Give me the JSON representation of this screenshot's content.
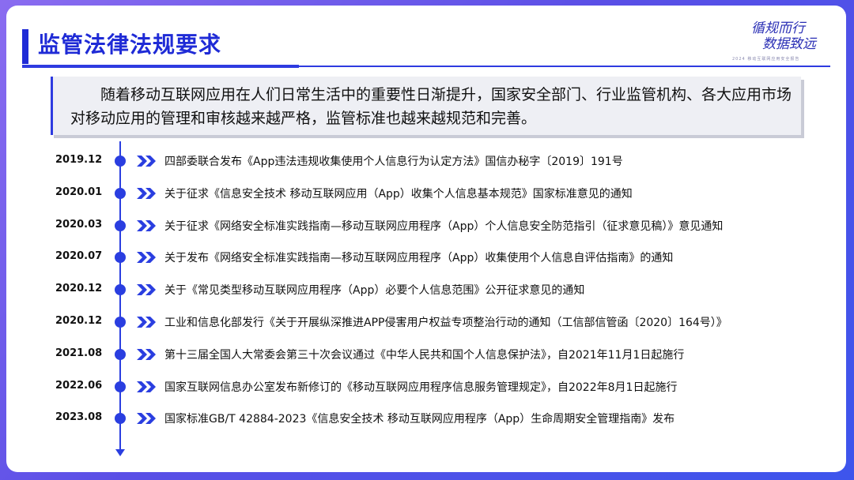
{
  "header": {
    "title": "监管法律法规要求",
    "logo_line1": "循规而行",
    "logo_line2": "数据致远",
    "logo_sub": "2024 移动互联网应用安全报告"
  },
  "intro": "随着移动互联网应用在人们日常生活中的重要性日渐提升，国家安全部门、行业监管机构、各大应用市场对移动应用的管理和审核越来越严格，监管标准也越来越规范和完善。",
  "colors": {
    "accent": "#2e3be0",
    "title": "#1f2bd6",
    "background_gradient": [
      "#8a6cf0",
      "#3d55ec"
    ]
  },
  "timeline": [
    {
      "date": "2019.12",
      "text": "四部委联合发布《App违法违规收集使用个人信息行为认定方法》国信办秘字〔2019〕191号"
    },
    {
      "date": "2020.01",
      "text": "关于征求《信息安全技术 移动互联网应用（App）收集个人信息基本规范》国家标准意见的通知"
    },
    {
      "date": "2020.03",
      "text": "关于征求《网络安全标准实践指南—移动互联网应用程序（App）个人信息安全防范指引（征求意见稿）》意见通知"
    },
    {
      "date": "2020.07",
      "text": "关于发布《网络安全标准实践指南—移动互联网应用程序（App）收集使用个人信息自评估指南》的通知"
    },
    {
      "date": "2020.12",
      "text": "关于《常见类型移动互联网应用程序（App）必要个人信息范围》公开征求意见的通知"
    },
    {
      "date": "2020.12",
      "text": "工业和信息化部发行《关于开展纵深推进APP侵害用户权益专项整治行动的通知（工信部信管函〔2020〕164号）》"
    },
    {
      "date": "2021.08",
      "text": "第十三届全国人大常委会第三十次会议通过《中华人民共和国个人信息保护法》，自2021年11月1日起施行"
    },
    {
      "date": "2022.06",
      "text": "国家互联网信息办公室发布新修订的《移动互联网应用程序信息服务管理规定》，自2022年8月1日起施行"
    },
    {
      "date": "2023.08",
      "text": "国家标准GB/T 42884-2023《信息安全技术 移动互联网应用程序（App）生命周期安全管理指南》发布"
    }
  ]
}
